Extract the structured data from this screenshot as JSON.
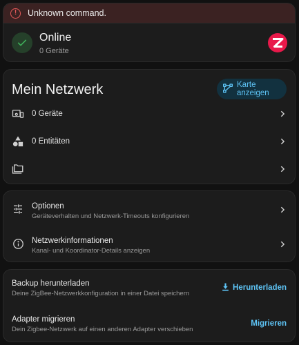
{
  "alert": {
    "text": "Unknown command.",
    "icon": "alert-circle-icon",
    "color": "#e45959"
  },
  "status": {
    "title": "Online",
    "subtitle": "0 Geräte",
    "logo_letter": "Z",
    "logo_color": "#e8194a",
    "ok_color": "#3fae5a"
  },
  "network": {
    "title": "Mein Netzwerk",
    "map_button_label": "Karte anzeigen",
    "rows": [
      {
        "label": "0 Geräte",
        "icon": "devices-icon"
      },
      {
        "label": "0 Entitäten",
        "icon": "shapes-icon"
      },
      {
        "label": "",
        "icon": "folder-multiple-icon"
      }
    ]
  },
  "options": [
    {
      "title": "Optionen",
      "subtitle": "Geräteverhalten und Netzwerk-Timeouts konfigurieren",
      "icon": "tune-icon"
    },
    {
      "title": "Netzwerkinformationen",
      "subtitle": "Kanal- und Koordinator-Details anzeigen",
      "icon": "info-icon"
    }
  ],
  "backup": [
    {
      "title": "Backup herunterladen",
      "subtitle": "Deine ZigBee-Netzwerkkonfiguration in einer Datei speichern",
      "button_label": "Herunterladen",
      "button_icon": "download-icon"
    },
    {
      "title": "Adapter migrieren",
      "subtitle": "Dein Zigbee-Netzwerk auf einen anderen Adapter verschieben",
      "button_label": "Migrieren"
    }
  ],
  "accent": "#5ec4f6"
}
